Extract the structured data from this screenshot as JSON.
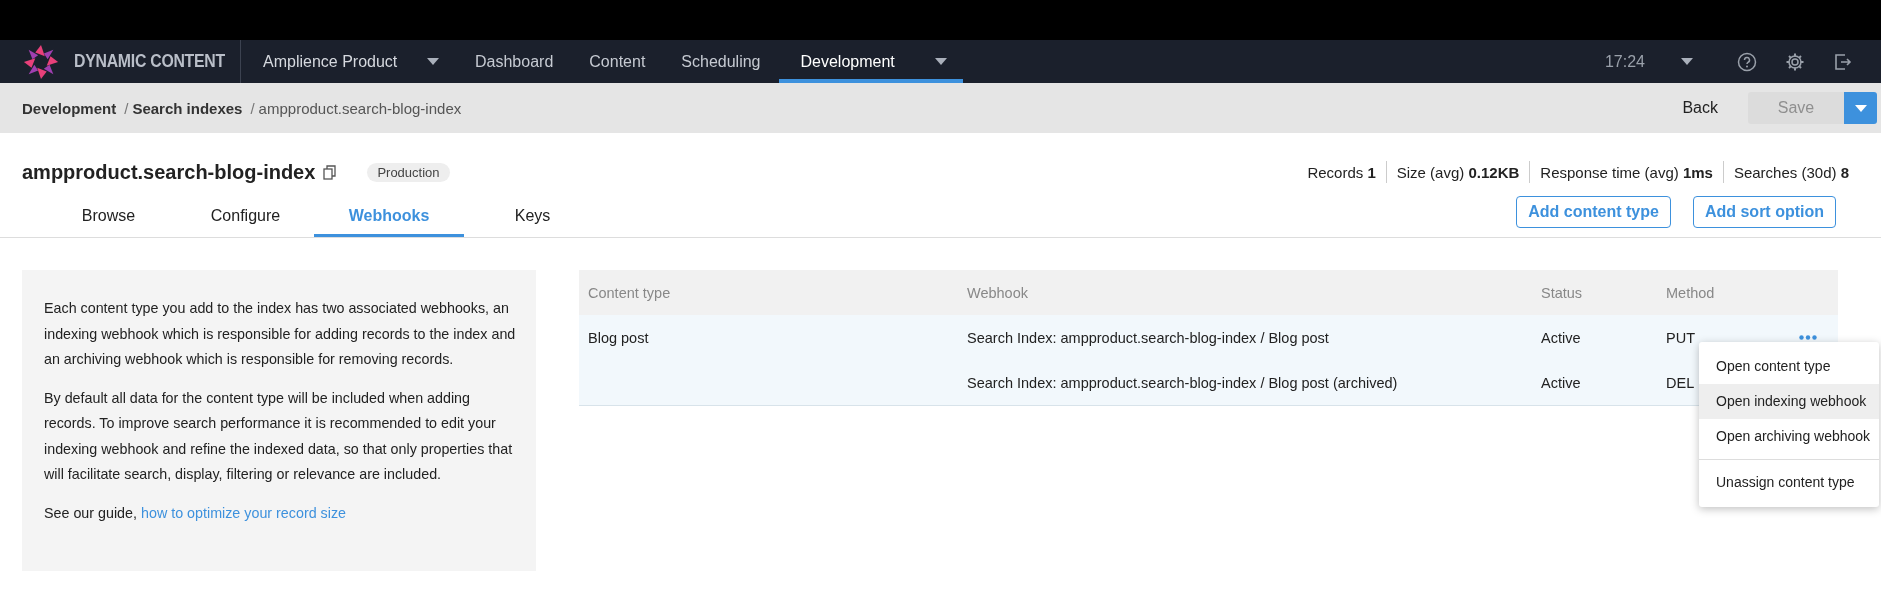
{
  "app_bar": {
    "brand": "DYNAMIC CONTENT",
    "hub": "Amplience Product",
    "nav": [
      {
        "label": "Dashboard",
        "selected": false,
        "dropdown": false
      },
      {
        "label": "Content",
        "selected": false,
        "dropdown": false
      },
      {
        "label": "Scheduling",
        "selected": false,
        "dropdown": false
      },
      {
        "label": "Development",
        "selected": true,
        "dropdown": true
      }
    ],
    "time": "17:24"
  },
  "breadcrumb": {
    "separator": "/",
    "items": [
      {
        "label": "Development",
        "current": false
      },
      {
        "label": "Search indexes",
        "current": false
      },
      {
        "label": "ampproduct.search-blog-index",
        "current": true
      }
    ],
    "back": "Back",
    "save": {
      "label": "Save",
      "disabled": true
    }
  },
  "header": {
    "title": "ampproduct.search-blog-index",
    "badge": "Production",
    "stats": [
      "Records **1**",
      "Size (avg) **0.12KB**",
      "Response time (avg) **1ms**",
      "Searches (30d) **8**"
    ]
  },
  "tabs": [
    {
      "label": "Browse",
      "selected": false
    },
    {
      "label": "Configure",
      "selected": false
    },
    {
      "label": "Webhooks",
      "selected": true
    },
    {
      "label": "Keys",
      "selected": false
    }
  ],
  "actions": [
    "Add content type",
    "Add sort option"
  ],
  "info": {
    "paragraphs": [
      "Each content type you add to the index has two associated webhooks, an indexing webhook which is responsible for adding records to the index and an archiving webhook which is responsible for removing records.",
      "By default all data for the content type will be included when adding records. To improve search performance it is recommended to edit your indexing webhook and refine the indexed data, so that only properties that will facilitate search, display, filtering or relevance are included."
    ],
    "guide": "See our guide, ",
    "link": "how to optimize your record size"
  },
  "table": {
    "columns": [
      "Content type",
      "Webhook",
      "Status",
      "Method"
    ],
    "rows": [
      {
        "content_type": "Blog post",
        "webhook": "Search Index: ampproduct.search-blog-index / Blog post",
        "status": "Active",
        "method": "PUT"
      },
      {
        "webhook": "Search Index: ampproduct.search-blog-index / Blog post (archived)",
        "status": "Active",
        "method": "DEL"
      }
    ]
  },
  "menu": [
    {
      "label": "Open content type",
      "selected": false,
      "divider_before": false
    },
    {
      "label": "Open indexing webhook",
      "selected": true,
      "divider_before": false
    },
    {
      "label": "Open archiving webhook",
      "selected": false,
      "divider_before": false
    },
    {
      "label": "Unassign content type",
      "selected": false,
      "divider_before": true
    }
  ]
}
